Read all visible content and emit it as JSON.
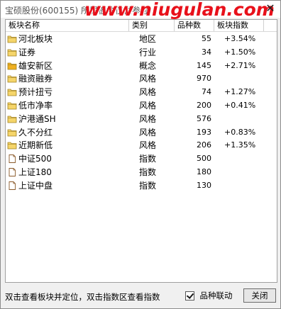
{
  "window": {
    "title": "宝硕股份(600155)  所属板块仅供参考",
    "watermark": "www.niugulan.com",
    "close_label": "✕"
  },
  "table": {
    "headers": [
      "板块名称",
      "类别",
      "品种数",
      "板块指数"
    ],
    "rows": [
      {
        "name": "河北板块",
        "type": "地区",
        "count": "55",
        "index": "+3.54%",
        "icon": "folder-icon"
      },
      {
        "name": "证券",
        "type": "行业",
        "count": "34",
        "index": "+1.50%",
        "icon": "folder-icon"
      },
      {
        "name": "雄安新区",
        "type": "概念",
        "count": "145",
        "index": "+2.71%",
        "icon": "folder-filled-icon"
      },
      {
        "name": "融资融券",
        "type": "风格",
        "count": "970",
        "index": "",
        "icon": "folder-icon"
      },
      {
        "name": "预计扭亏",
        "type": "风格",
        "count": "74",
        "index": "+1.27%",
        "icon": "folder-icon"
      },
      {
        "name": "低市净率",
        "type": "风格",
        "count": "200",
        "index": "+0.41%",
        "icon": "folder-icon"
      },
      {
        "name": "沪港通SH",
        "type": "风格",
        "count": "576",
        "index": "",
        "icon": "folder-icon"
      },
      {
        "name": "久不分红",
        "type": "风格",
        "count": "193",
        "index": "+0.83%",
        "icon": "folder-icon"
      },
      {
        "name": "近期新低",
        "type": "风格",
        "count": "206",
        "index": "+1.35%",
        "icon": "folder-icon"
      },
      {
        "name": "中证500",
        "type": "指数",
        "count": "500",
        "index": "",
        "icon": "document-icon"
      },
      {
        "name": "上证180",
        "type": "指数",
        "count": "180",
        "index": "",
        "icon": "document-icon"
      },
      {
        "name": "上证中盘",
        "type": "指数",
        "count": "130",
        "index": "",
        "icon": "document-icon"
      }
    ]
  },
  "footer": {
    "hint": "双击查看板块并定位，双击指数区查看指数",
    "checkbox_label": "品种联动",
    "checkbox_checked": true,
    "close_button": "关闭"
  },
  "colors": {
    "watermark": "#e8101a",
    "folder": "#f5d56a",
    "folder_filled": "#f0b020"
  }
}
